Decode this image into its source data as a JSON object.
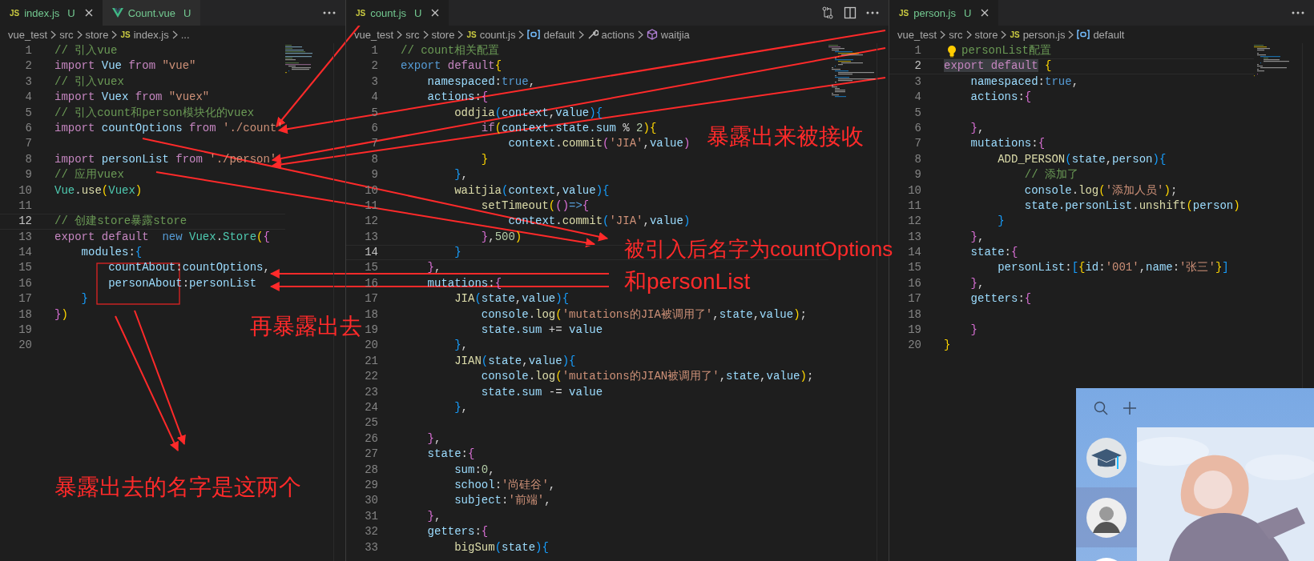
{
  "panes": [
    {
      "tabs": [
        {
          "label": "index.js",
          "status": "U",
          "kind": "js",
          "icon": "JS",
          "selected": true
        },
        {
          "label": "Count.vue",
          "status": "U",
          "kind": "vue",
          "selected": false
        }
      ],
      "breadcrumbs": [
        {
          "label": "vue_test",
          "kind": "folder"
        },
        {
          "label": "src",
          "kind": "folder"
        },
        {
          "label": "store",
          "kind": "folder"
        },
        {
          "label": "index.js",
          "kind": "file",
          "icon": "JS"
        },
        {
          "label": "...",
          "kind": "more"
        }
      ],
      "lines": [
        {
          "number": "1",
          "current": false,
          "tokens": [
            {
              "text": "// 引入vue",
              "kind": "comment"
            }
          ]
        },
        {
          "number": "2",
          "current": false,
          "tokens": [
            {
              "text": "import ",
              "kind": "keyword"
            },
            {
              "text": "Vue ",
              "kind": "variable"
            },
            {
              "text": "from ",
              "kind": "keyword"
            },
            {
              "text": "\"vue\"",
              "kind": "string"
            }
          ]
        },
        {
          "number": "3",
          "current": false,
          "tokens": [
            {
              "text": "// 引入vuex",
              "kind": "comment"
            }
          ]
        },
        {
          "number": "4",
          "current": false,
          "tokens": [
            {
              "text": "import ",
              "kind": "keyword"
            },
            {
              "text": "Vuex ",
              "kind": "variable"
            },
            {
              "text": "from ",
              "kind": "keyword"
            },
            {
              "text": "\"vuex\"",
              "kind": "string"
            }
          ]
        },
        {
          "number": "5",
          "current": false,
          "tokens": [
            {
              "text": "// 引入count和person模块化的vuex",
              "kind": "comment"
            }
          ]
        },
        {
          "number": "6",
          "current": false,
          "tokens": [
            {
              "text": "import ",
              "kind": "keyword"
            },
            {
              "text": "countOptions ",
              "kind": "variable"
            },
            {
              "text": "from ",
              "kind": "keyword"
            },
            {
              "text": "'./count'",
              "kind": "string"
            }
          ]
        },
        {
          "number": "7",
          "current": false
        },
        {
          "number": "8",
          "current": false,
          "tokens": [
            {
              "text": "import ",
              "kind": "keyword"
            },
            {
              "text": "personList ",
              "kind": "variable"
            },
            {
              "text": "from ",
              "kind": "keyword"
            },
            {
              "text": "'./person'",
              "kind": "string"
            }
          ]
        },
        {
          "number": "9",
          "current": false,
          "tokens": [
            {
              "text": "// 应用vuex",
              "kind": "comment"
            }
          ]
        },
        {
          "number": "10",
          "current": false,
          "tokens": [
            {
              "text": "Vue",
              "kind": "class"
            },
            {
              "text": ".",
              "kind": "plain"
            },
            {
              "text": "use",
              "kind": "function"
            },
            {
              "text": "(",
              "kind": "bracket1"
            },
            {
              "text": "Vuex",
              "kind": "class"
            },
            {
              "text": ")",
              "kind": "bracket1"
            }
          ]
        },
        {
          "number": "11",
          "current": false
        },
        {
          "number": "12",
          "current": true,
          "tokens": [
            {
              "text": "// 创建store暴露store",
              "kind": "comment"
            }
          ]
        },
        {
          "number": "13",
          "current": false,
          "tokens": [
            {
              "text": "export ",
              "kind": "keyword"
            },
            {
              "text": "default  ",
              "kind": "keyword"
            },
            {
              "text": "new ",
              "kind": "storage"
            },
            {
              "text": "Vuex",
              "kind": "class"
            },
            {
              "text": ".",
              "kind": "plain"
            },
            {
              "text": "Store",
              "kind": "class"
            },
            {
              "text": "(",
              "kind": "bracket1"
            },
            {
              "text": "{",
              "kind": "bracket2"
            }
          ]
        },
        {
          "number": "14",
          "current": false,
          "tokens": [
            {
              "text": "    modules",
              "kind": "variable"
            },
            {
              "text": ":",
              "kind": "plain"
            },
            {
              "text": "{",
              "kind": "bracket3"
            }
          ]
        },
        {
          "number": "15",
          "current": false,
          "tokens": [
            {
              "text": "        countAbout",
              "kind": "variable"
            },
            {
              "text": ":",
              "kind": "plain"
            },
            {
              "text": "countOptions",
              "kind": "variable"
            },
            {
              "text": ",",
              "kind": "plain"
            }
          ]
        },
        {
          "number": "16",
          "current": false,
          "tokens": [
            {
              "text": "        personAbout",
              "kind": "variable"
            },
            {
              "text": ":",
              "kind": "plain"
            },
            {
              "text": "personList",
              "kind": "variable"
            }
          ]
        },
        {
          "number": "17",
          "current": false,
          "tokens": [
            {
              "text": "    }",
              "kind": "bracket3"
            }
          ]
        },
        {
          "number": "18",
          "current": false,
          "tokens": [
            {
              "text": "}",
              "kind": "bracket2"
            },
            {
              "text": ")",
              "kind": "bracket1"
            }
          ]
        },
        {
          "number": "19",
          "current": false
        },
        {
          "number": "20",
          "current": false
        }
      ]
    },
    {
      "tabs": [
        {
          "label": "count.js",
          "status": "U",
          "kind": "js",
          "icon": "JS",
          "selected": true
        }
      ],
      "breadcrumbs": [
        {
          "label": "vue_test",
          "kind": "folder"
        },
        {
          "label": "src",
          "kind": "folder"
        },
        {
          "label": "store",
          "kind": "folder"
        },
        {
          "label": "count.js",
          "kind": "file",
          "icon": "JS"
        },
        {
          "label": "default",
          "kind": "symbol"
        },
        {
          "label": "actions",
          "kind": "method"
        },
        {
          "label": "waitjia",
          "kind": "object"
        }
      ],
      "lines": [
        {
          "number": "1",
          "current": false,
          "tokens": [
            {
              "text": "// count相关配置",
              "kind": "comment"
            }
          ]
        },
        {
          "number": "2",
          "current": false,
          "tokens": [
            {
              "text": "export ",
              "kind": "storage"
            },
            {
              "text": "default",
              "kind": "keyword"
            },
            {
              "text": "{",
              "kind": "bracket1"
            }
          ]
        },
        {
          "number": "3",
          "current": false,
          "tokens": [
            {
              "text": "    namespaced",
              "kind": "variable"
            },
            {
              "text": ":",
              "kind": "plain"
            },
            {
              "text": "true",
              "kind": "storage"
            },
            {
              "text": ",",
              "kind": "plain"
            }
          ]
        },
        {
          "number": "4",
          "current": false,
          "tokens": [
            {
              "text": "    actions",
              "kind": "variable"
            },
            {
              "text": ":",
              "kind": "plain"
            },
            {
              "text": "{",
              "kind": "bracket2"
            }
          ]
        },
        {
          "number": "5",
          "current": false,
          "tokens": [
            {
              "text": "        oddjia",
              "kind": "function"
            },
            {
              "text": "(",
              "kind": "bracket3"
            },
            {
              "text": "context",
              "kind": "variable"
            },
            {
              "text": ",",
              "kind": "plain"
            },
            {
              "text": "value",
              "kind": "variable"
            },
            {
              "text": ")",
              "kind": "bracket3"
            },
            {
              "text": "{",
              "kind": "bracket3"
            }
          ]
        },
        {
          "number": "6",
          "current": false,
          "tokens": [
            {
              "text": "            if",
              "kind": "keyword"
            },
            {
              "text": "(",
              "kind": "bracket1"
            },
            {
              "text": "context.state.sum",
              "kind": "variable"
            },
            {
              "text": " % ",
              "kind": "plain"
            },
            {
              "text": "2",
              "kind": "number"
            },
            {
              "text": ")",
              "kind": "bracket1"
            },
            {
              "text": "{",
              "kind": "bracket1"
            }
          ]
        },
        {
          "number": "7",
          "current": false,
          "tokens": [
            {
              "text": "                context",
              "kind": "variable"
            },
            {
              "text": ".",
              "kind": "plain"
            },
            {
              "text": "commit",
              "kind": "function"
            },
            {
              "text": "(",
              "kind": "bracket2"
            },
            {
              "text": "'JIA'",
              "kind": "string"
            },
            {
              "text": ",",
              "kind": "plain"
            },
            {
              "text": "value",
              "kind": "variable"
            },
            {
              "text": ")",
              "kind": "bracket2"
            }
          ]
        },
        {
          "number": "8",
          "current": false,
          "tokens": [
            {
              "text": "            }",
              "kind": "bracket1"
            }
          ]
        },
        {
          "number": "9",
          "current": false,
          "tokens": [
            {
              "text": "        }",
              "kind": "bracket3"
            },
            {
              "text": ",",
              "kind": "plain"
            }
          ]
        },
        {
          "number": "10",
          "current": false,
          "tokens": [
            {
              "text": "        waitjia",
              "kind": "function"
            },
            {
              "text": "(",
              "kind": "bracket3"
            },
            {
              "text": "context",
              "kind": "variable"
            },
            {
              "text": ",",
              "kind": "plain"
            },
            {
              "text": "value",
              "kind": "variable"
            },
            {
              "text": ")",
              "kind": "bracket3"
            },
            {
              "text": "{",
              "kind": "bracket3"
            }
          ]
        },
        {
          "number": "11",
          "current": false,
          "tokens": [
            {
              "text": "            setTimeout",
              "kind": "function"
            },
            {
              "text": "(",
              "kind": "bracket1"
            },
            {
              "text": "()",
              "kind": "bracket2"
            },
            {
              "text": "=>",
              "kind": "storage"
            },
            {
              "text": "{",
              "kind": "bracket2"
            }
          ]
        },
        {
          "number": "12",
          "current": false,
          "tokens": [
            {
              "text": "                context",
              "kind": "variable"
            },
            {
              "text": ".",
              "kind": "plain"
            },
            {
              "text": "commit",
              "kind": "function"
            },
            {
              "text": "(",
              "kind": "bracket3"
            },
            {
              "text": "'JIA'",
              "kind": "string"
            },
            {
              "text": ",",
              "kind": "plain"
            },
            {
              "text": "value",
              "kind": "variable"
            },
            {
              "text": ")",
              "kind": "bracket3"
            }
          ]
        },
        {
          "number": "13",
          "current": false,
          "tokens": [
            {
              "text": "            }",
              "kind": "bracket2"
            },
            {
              "text": ",",
              "kind": "plain"
            },
            {
              "text": "500",
              "kind": "number"
            },
            {
              "text": ")",
              "kind": "bracket1"
            }
          ]
        },
        {
          "number": "14",
          "current": true,
          "tokens": [
            {
              "text": "        }",
              "kind": "bracket3"
            }
          ]
        },
        {
          "number": "15",
          "current": false,
          "tokens": [
            {
              "text": "    }",
              "kind": "bracket2"
            },
            {
              "text": ",",
              "kind": "plain"
            }
          ]
        },
        {
          "number": "16",
          "current": false,
          "tokens": [
            {
              "text": "    mutations",
              "kind": "variable"
            },
            {
              "text": ":",
              "kind": "plain"
            },
            {
              "text": "{",
              "kind": "bracket2"
            }
          ]
        },
        {
          "number": "17",
          "current": false,
          "tokens": [
            {
              "text": "        JIA",
              "kind": "function"
            },
            {
              "text": "(",
              "kind": "bracket3"
            },
            {
              "text": "state",
              "kind": "variable"
            },
            {
              "text": ",",
              "kind": "plain"
            },
            {
              "text": "value",
              "kind": "variable"
            },
            {
              "text": ")",
              "kind": "bracket3"
            },
            {
              "text": "{",
              "kind": "bracket3"
            }
          ]
        },
        {
          "number": "18",
          "current": false,
          "tokens": [
            {
              "text": "            console",
              "kind": "variable"
            },
            {
              "text": ".",
              "kind": "plain"
            },
            {
              "text": "log",
              "kind": "function"
            },
            {
              "text": "(",
              "kind": "bracket1"
            },
            {
              "text": "'mutations的JIA被调用了'",
              "kind": "string"
            },
            {
              "text": ",",
              "kind": "plain"
            },
            {
              "text": "state",
              "kind": "variable"
            },
            {
              "text": ",",
              "kind": "plain"
            },
            {
              "text": "value",
              "kind": "variable"
            },
            {
              "text": ")",
              "kind": "bracket1"
            },
            {
              "text": ";",
              "kind": "plain"
            }
          ]
        },
        {
          "number": "19",
          "current": false,
          "tokens": [
            {
              "text": "            state.sum",
              "kind": "variable"
            },
            {
              "text": " += ",
              "kind": "plain"
            },
            {
              "text": "value",
              "kind": "variable"
            }
          ]
        },
        {
          "number": "20",
          "current": false,
          "tokens": [
            {
              "text": "        }",
              "kind": "bracket3"
            },
            {
              "text": ",",
              "kind": "plain"
            }
          ]
        },
        {
          "number": "21",
          "current": false,
          "tokens": [
            {
              "text": "        JIAN",
              "kind": "function"
            },
            {
              "text": "(",
              "kind": "bracket3"
            },
            {
              "text": "state",
              "kind": "variable"
            },
            {
              "text": ",",
              "kind": "plain"
            },
            {
              "text": "value",
              "kind": "variable"
            },
            {
              "text": ")",
              "kind": "bracket3"
            },
            {
              "text": "{",
              "kind": "bracket3"
            }
          ]
        },
        {
          "number": "22",
          "current": false,
          "tokens": [
            {
              "text": "            console",
              "kind": "variable"
            },
            {
              "text": ".",
              "kind": "plain"
            },
            {
              "text": "log",
              "kind": "function"
            },
            {
              "text": "(",
              "kind": "bracket1"
            },
            {
              "text": "'mutations的JIAN被调用了'",
              "kind": "string"
            },
            {
              "text": ",",
              "kind": "plain"
            },
            {
              "text": "state",
              "kind": "variable"
            },
            {
              "text": ",",
              "kind": "plain"
            },
            {
              "text": "value",
              "kind": "variable"
            },
            {
              "text": ")",
              "kind": "bracket1"
            },
            {
              "text": ";",
              "kind": "plain"
            }
          ]
        },
        {
          "number": "23",
          "current": false,
          "tokens": [
            {
              "text": "            state.sum",
              "kind": "variable"
            },
            {
              "text": " -= ",
              "kind": "plain"
            },
            {
              "text": "value",
              "kind": "variable"
            }
          ]
        },
        {
          "number": "24",
          "current": false,
          "tokens": [
            {
              "text": "        }",
              "kind": "bracket3"
            },
            {
              "text": ",",
              "kind": "plain"
            }
          ]
        },
        {
          "number": "25",
          "current": false
        },
        {
          "number": "26",
          "current": false,
          "tokens": [
            {
              "text": "    }",
              "kind": "bracket2"
            },
            {
              "text": ",",
              "kind": "plain"
            }
          ]
        },
        {
          "number": "27",
          "current": false,
          "tokens": [
            {
              "text": "    state",
              "kind": "variable"
            },
            {
              "text": ":",
              "kind": "plain"
            },
            {
              "text": "{",
              "kind": "bracket2"
            }
          ]
        },
        {
          "number": "28",
          "current": false,
          "tokens": [
            {
              "text": "        sum",
              "kind": "variable"
            },
            {
              "text": ":",
              "kind": "plain"
            },
            {
              "text": "0",
              "kind": "number"
            },
            {
              "text": ",",
              "kind": "plain"
            }
          ]
        },
        {
          "number": "29",
          "current": false,
          "tokens": [
            {
              "text": "        school",
              "kind": "variable"
            },
            {
              "text": ":",
              "kind": "plain"
            },
            {
              "text": "'尚硅谷'",
              "kind": "string"
            },
            {
              "text": ",",
              "kind": "plain"
            }
          ]
        },
        {
          "number": "30",
          "current": false,
          "tokens": [
            {
              "text": "        subject",
              "kind": "variable"
            },
            {
              "text": ":",
              "kind": "plain"
            },
            {
              "text": "'前端'",
              "kind": "string"
            },
            {
              "text": ",",
              "kind": "plain"
            }
          ]
        },
        {
          "number": "31",
          "current": false,
          "tokens": [
            {
              "text": "    }",
              "kind": "bracket2"
            },
            {
              "text": ",",
              "kind": "plain"
            }
          ]
        },
        {
          "number": "32",
          "current": false,
          "tokens": [
            {
              "text": "    getters",
              "kind": "variable"
            },
            {
              "text": ":",
              "kind": "plain"
            },
            {
              "text": "{",
              "kind": "bracket2"
            }
          ]
        },
        {
          "number": "33",
          "current": false,
          "tokens": [
            {
              "text": "        bigSum",
              "kind": "function"
            },
            {
              "text": "(",
              "kind": "bracket3"
            },
            {
              "text": "state",
              "kind": "variable"
            },
            {
              "text": ")",
              "kind": "bracket3"
            },
            {
              "text": "{",
              "kind": "bracket3"
            }
          ]
        }
      ]
    },
    {
      "tabs": [
        {
          "label": "person.js",
          "status": "U",
          "kind": "js",
          "icon": "JS",
          "selected": true
        }
      ],
      "breadcrumbs": [
        {
          "label": "vue_test",
          "kind": "folder"
        },
        {
          "label": "src",
          "kind": "folder"
        },
        {
          "label": "store",
          "kind": "folder"
        },
        {
          "label": "person.js",
          "kind": "file",
          "icon": "JS"
        },
        {
          "label": "default",
          "kind": "symbol"
        }
      ],
      "lines": [
        {
          "number": "1",
          "current": false,
          "tokens": [
            {
              "kind": "lightbulb"
            },
            {
              "text": "personList配置",
              "kind": "comment"
            }
          ]
        },
        {
          "number": "2",
          "current": true,
          "tokens": [
            {
              "text": "export default",
              "kind": "selection"
            },
            {
              "text": " {",
              "kind": "bracket1"
            }
          ]
        },
        {
          "number": "3",
          "current": false,
          "tokens": [
            {
              "text": "    namespaced",
              "kind": "variable"
            },
            {
              "text": ":",
              "kind": "plain"
            },
            {
              "text": "true",
              "kind": "storage"
            },
            {
              "text": ",",
              "kind": "plain"
            }
          ]
        },
        {
          "number": "4",
          "current": false,
          "tokens": [
            {
              "text": "    actions",
              "kind": "variable"
            },
            {
              "text": ":",
              "kind": "plain"
            },
            {
              "text": "{",
              "kind": "bracket2"
            }
          ]
        },
        {
          "number": "5",
          "current": false
        },
        {
          "number": "6",
          "current": false,
          "tokens": [
            {
              "text": "    }",
              "kind": "bracket2"
            },
            {
              "text": ",",
              "kind": "plain"
            }
          ]
        },
        {
          "number": "7",
          "current": false,
          "tokens": [
            {
              "text": "    mutations",
              "kind": "variable"
            },
            {
              "text": ":",
              "kind": "plain"
            },
            {
              "text": "{",
              "kind": "bracket2"
            }
          ]
        },
        {
          "number": "8",
          "current": false,
          "tokens": [
            {
              "text": "        ADD_PERSON",
              "kind": "function"
            },
            {
              "text": "(",
              "kind": "bracket3"
            },
            {
              "text": "state",
              "kind": "variable"
            },
            {
              "text": ",",
              "kind": "plain"
            },
            {
              "text": "person",
              "kind": "variable"
            },
            {
              "text": ")",
              "kind": "bracket3"
            },
            {
              "text": "{",
              "kind": "bracket3"
            }
          ]
        },
        {
          "number": "9",
          "current": false,
          "tokens": [
            {
              "text": "            // 添加了",
              "kind": "comment"
            }
          ]
        },
        {
          "number": "10",
          "current": false,
          "tokens": [
            {
              "text": "            console",
              "kind": "variable"
            },
            {
              "text": ".",
              "kind": "plain"
            },
            {
              "text": "log",
              "kind": "function"
            },
            {
              "text": "(",
              "kind": "bracket1"
            },
            {
              "text": "'添加人员'",
              "kind": "string"
            },
            {
              "text": ")",
              "kind": "bracket1"
            },
            {
              "text": ";",
              "kind": "plain"
            }
          ]
        },
        {
          "number": "11",
          "current": false,
          "tokens": [
            {
              "text": "            state.personList",
              "kind": "variable"
            },
            {
              "text": ".",
              "kind": "plain"
            },
            {
              "text": "unshift",
              "kind": "function"
            },
            {
              "text": "(",
              "kind": "bracket1"
            },
            {
              "text": "person",
              "kind": "variable"
            },
            {
              "text": ")",
              "kind": "bracket1"
            }
          ]
        },
        {
          "number": "12",
          "current": false,
          "tokens": [
            {
              "text": "        }",
              "kind": "bracket3"
            }
          ]
        },
        {
          "number": "13",
          "current": false,
          "tokens": [
            {
              "text": "    }",
              "kind": "bracket2"
            },
            {
              "text": ",",
              "kind": "plain"
            }
          ]
        },
        {
          "number": "14",
          "current": false,
          "tokens": [
            {
              "text": "    state",
              "kind": "variable"
            },
            {
              "text": ":",
              "kind": "plain"
            },
            {
              "text": "{",
              "kind": "bracket2"
            }
          ]
        },
        {
          "number": "15",
          "current": false,
          "tokens": [
            {
              "text": "        personList",
              "kind": "variable"
            },
            {
              "text": ":",
              "kind": "plain"
            },
            {
              "text": "[",
              "kind": "bracket3"
            },
            {
              "text": "{",
              "kind": "bracket1"
            },
            {
              "text": "id",
              "kind": "variable"
            },
            {
              "text": ":",
              "kind": "plain"
            },
            {
              "text": "'001'",
              "kind": "string"
            },
            {
              "text": ",",
              "kind": "plain"
            },
            {
              "text": "name",
              "kind": "variable"
            },
            {
              "text": ":",
              "kind": "plain"
            },
            {
              "text": "'张三'",
              "kind": "string"
            },
            {
              "text": "}",
              "kind": "bracket1"
            },
            {
              "text": "]",
              "kind": "bracket3"
            }
          ]
        },
        {
          "number": "16",
          "current": false,
          "tokens": [
            {
              "text": "    }",
              "kind": "bracket2"
            },
            {
              "text": ",",
              "kind": "plain"
            }
          ]
        },
        {
          "number": "17",
          "current": false,
          "tokens": [
            {
              "text": "    getters",
              "kind": "variable"
            },
            {
              "text": ":",
              "kind": "plain"
            },
            {
              "text": "{",
              "kind": "bracket2"
            }
          ]
        },
        {
          "number": "18",
          "current": false
        },
        {
          "number": "19",
          "current": false,
          "tokens": [
            {
              "text": "    }",
              "kind": "bracket2"
            }
          ]
        },
        {
          "number": "20",
          "current": false,
          "tokens": [
            {
              "text": "}",
              "kind": "bracket1"
            }
          ]
        }
      ]
    }
  ],
  "chat_window": {
    "contacts": [
      {
        "selected": false
      },
      {
        "selected": true
      },
      {
        "selected": false
      }
    ]
  },
  "annotations": {
    "labels": [
      "暴露出来被接收",
      "被引入后名字为countOptions",
      "和personList",
      "再暴露出去",
      "暴露出去的名字是这两个"
    ]
  }
}
